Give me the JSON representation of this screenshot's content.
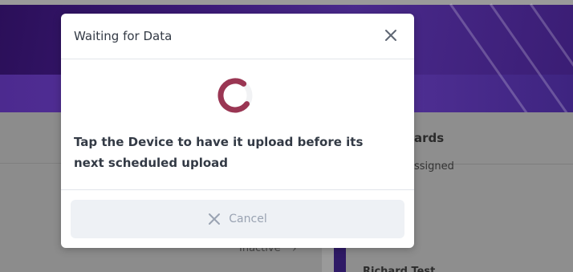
{
  "background": {
    "cards_title": "ards",
    "assigned_text": "ssigned",
    "status_text": "Inactive",
    "user_name": "Richard Test"
  },
  "modal": {
    "title": "Waiting for Data",
    "message": "Tap the Device to have it upload before its next scheduled upload",
    "cancel_label": "Cancel",
    "spinner_color": "#9a3653",
    "close_icon": "close-icon",
    "cancel_icon": "close-icon"
  }
}
